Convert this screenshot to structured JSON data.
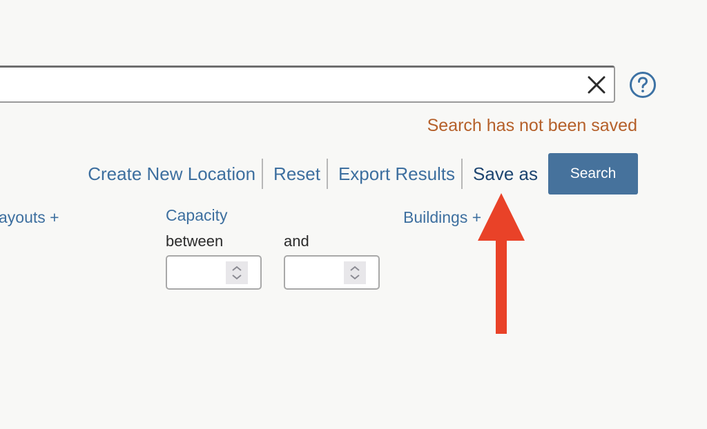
{
  "search": {
    "value": "",
    "placeholder": "",
    "clear_icon": "close-icon",
    "help_icon": "question-circle-icon"
  },
  "status": {
    "message": "Search has not been saved",
    "color": "#b5602a"
  },
  "actions": {
    "create_new_location": "Create New Location",
    "reset": "Reset",
    "export_results": "Export Results",
    "save_as": "Save as",
    "search_button": "Search"
  },
  "filters": {
    "layouts_label": "ayouts +",
    "capacity": {
      "label": "Capacity",
      "between_label": "between",
      "and_label": "and",
      "min_value": "",
      "max_value": ""
    },
    "buildings_label": "Buildings +"
  },
  "annotation": {
    "type": "arrow-up",
    "color": "#e94228",
    "points_to": "Save as"
  },
  "colors": {
    "link": "#3d6f9f",
    "link_active": "#1d4570",
    "primary_button": "#46729c",
    "background": "#f8f8f6"
  }
}
